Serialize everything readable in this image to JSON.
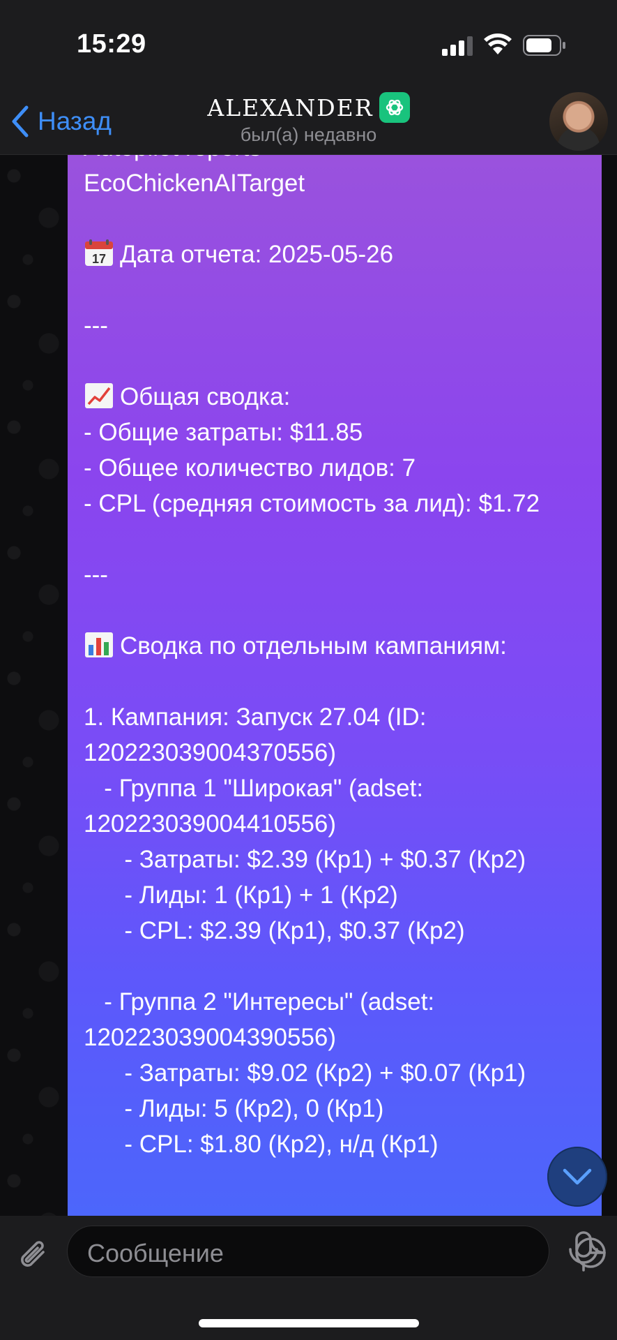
{
  "status_bar": {
    "time": "15:29"
  },
  "header": {
    "back_label": "Назад",
    "title": "ALEXANDER",
    "subtitle": "был(а) недавно"
  },
  "message": {
    "lines": [
      "Autopilot reports",
      "EcoChickenAITarget",
      "",
      "Дата отчета: 2025-05-26",
      "",
      "---",
      "",
      "Общая сводка:",
      "- Общие затраты: $11.85",
      "- Общее количество лидов: 7",
      "- CPL (средняя стоимость за лид): $1.72",
      "",
      "---",
      "",
      "Сводка по отдельным кампаниям:",
      "",
      "1. Кампания: Запуск 27.04 (ID:",
      "120223039004370556)",
      "   - Группа 1 \"Широкая\" (adset:",
      "120223039004410556)",
      "      - Затраты: $2.39 (Кр1) + $0.37 (Кр2)",
      "      - Лиды: 1 (Кр1) + 1 (Кр2)",
      "      - CPL: $2.39 (Кр1), $0.37 (Кр2)",
      "",
      "   - Группа 2 \"Интересы\" (adset:",
      "120223039004390556)",
      "      - Затраты: $9.02 (Кр2) + $0.07 (Кр1)",
      "      - Лиды: 5 (Кр2), 0 (Кр1)",
      "      - CPL: $1.80 (Кр2), н/д (Кр1)"
    ],
    "emoji_lines": {
      "3": "calendar-icon",
      "7": "chart-increasing-icon",
      "14": "bar-chart-icon"
    }
  },
  "input": {
    "placeholder": "Сообщение"
  },
  "colors": {
    "accent": "#3e8ef7",
    "bubble_top": "#9a52dd",
    "bubble_bottom": "#4c66fb",
    "bar_bg": "#1c1c1e"
  }
}
